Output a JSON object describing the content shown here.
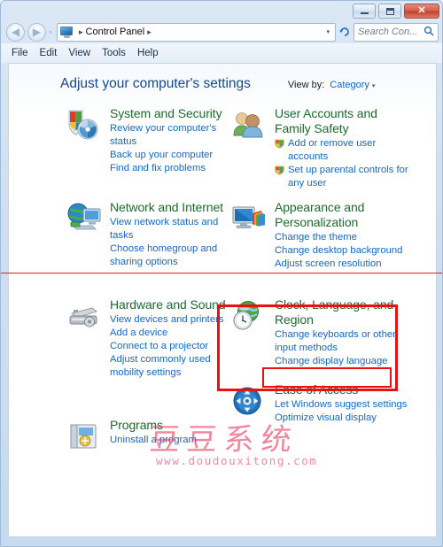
{
  "window": {
    "title": "Control Panel",
    "buttons": {
      "minimize": "minimize-button",
      "maximize": "maximize-button",
      "close": "✕"
    }
  },
  "address_bar": {
    "back": "◀",
    "forward": "▶",
    "separator_caret": "▸",
    "breadcrumb_root": "Control Panel",
    "breadcrumb_sep": "▸",
    "dropdown_caret": "▾",
    "refresh": "↻",
    "search_placeholder": "Search Con...",
    "search_value": "",
    "search_icon": "search-icon"
  },
  "menu": {
    "items": [
      {
        "label": "File"
      },
      {
        "label": "Edit"
      },
      {
        "label": "View"
      },
      {
        "label": "Tools"
      },
      {
        "label": "Help"
      }
    ]
  },
  "page": {
    "title": "Adjust your computer's settings",
    "view_by_label": "View by:",
    "view_by_value": "Category",
    "view_by_caret": "▾"
  },
  "categories": {
    "left": [
      {
        "icon": "system-security-icon",
        "title": "System and Security",
        "links": [
          {
            "text": "Review your computer's status",
            "shield": false
          },
          {
            "text": "Back up your computer",
            "shield": false
          },
          {
            "text": "Find and fix problems",
            "shield": false
          }
        ]
      },
      {
        "icon": "network-internet-icon",
        "title": "Network and Internet",
        "links": [
          {
            "text": "View network status and tasks",
            "shield": false
          },
          {
            "text": "Choose homegroup and sharing options",
            "shield": false
          }
        ]
      },
      {
        "icon": "hardware-sound-icon",
        "title": "Hardware and Sound",
        "links": [
          {
            "text": "View devices and printers",
            "shield": false
          },
          {
            "text": "Add a device",
            "shield": false
          },
          {
            "text": "Connect to a projector",
            "shield": false
          },
          {
            "text": "Adjust commonly used mobility settings",
            "shield": false
          }
        ]
      },
      {
        "icon": "programs-icon",
        "title": "Programs",
        "links": [
          {
            "text": "Uninstall a program",
            "shield": false
          }
        ]
      }
    ],
    "right": [
      {
        "icon": "user-accounts-icon",
        "title": "User Accounts and Family Safety",
        "links": [
          {
            "text": "Add or remove user accounts",
            "shield": true
          },
          {
            "text": "Set up parental controls for any user",
            "shield": true
          }
        ]
      },
      {
        "icon": "appearance-personalization-icon",
        "title": "Appearance and Personalization",
        "links": [
          {
            "text": "Change the theme",
            "shield": false
          },
          {
            "text": "Change desktop background",
            "shield": false
          },
          {
            "text": "Adjust screen resolution",
            "shield": false
          }
        ]
      },
      {
        "icon": "clock-language-region-icon",
        "title": "Clock, Language, and Region",
        "links": [
          {
            "text": "Change keyboards or other input methods",
            "shield": false
          },
          {
            "text": "Change display language",
            "shield": false
          }
        ]
      },
      {
        "icon": "ease-of-access-icon",
        "title": "Ease of Access",
        "links": [
          {
            "text": "Let Windows suggest settings",
            "shield": false
          },
          {
            "text": "Optimize visual display",
            "shield": false
          }
        ]
      }
    ]
  },
  "annotations": {
    "color": "#e81010",
    "divider_color": "#e02020",
    "outer_box_target": "Clock, Language, and Region",
    "inner_box_target": "Change display language"
  },
  "watermark": {
    "text_cn": "豆豆系统",
    "url": "www.doudouxitong.com",
    "color": "#e83c64"
  }
}
